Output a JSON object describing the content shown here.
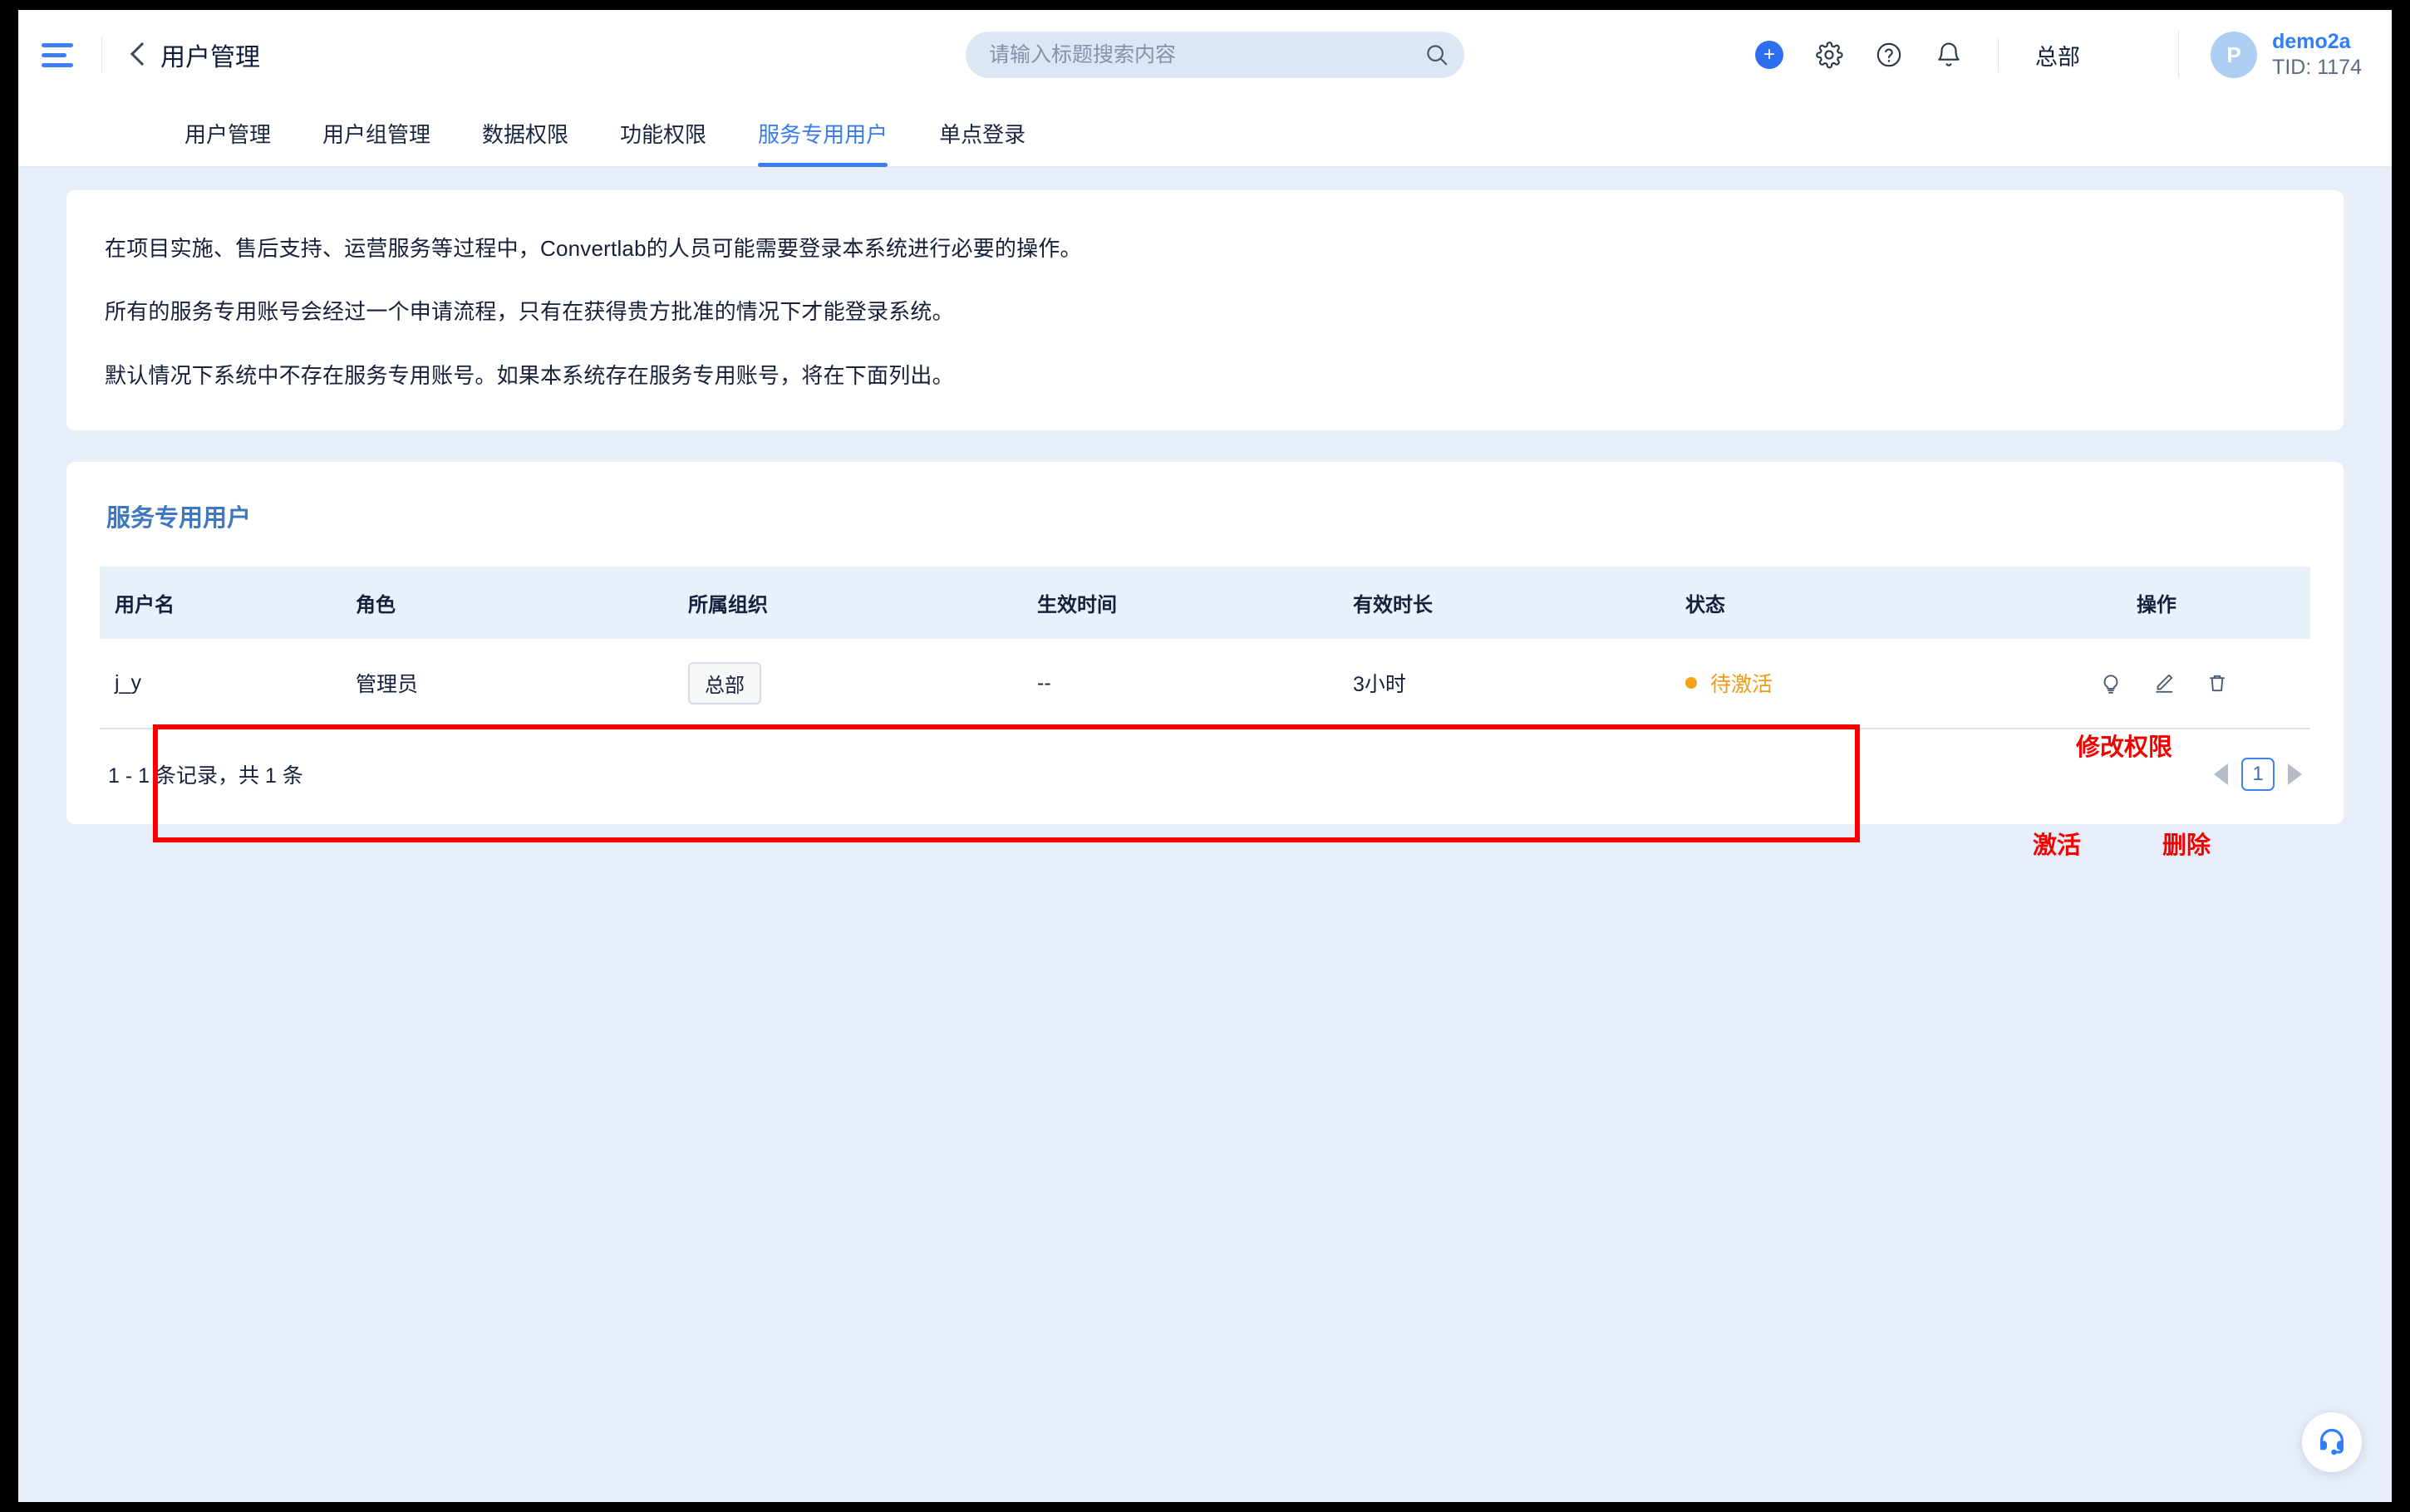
{
  "header": {
    "menu_icon": "hamburger-icon",
    "back_icon": "back-chevron-icon",
    "page_title": "用户管理",
    "search": {
      "placeholder": "请输入标题搜索内容",
      "value": "",
      "icon": "search-icon"
    },
    "actions": [
      {
        "name": "add-button",
        "icon": "plus-icon"
      },
      {
        "name": "settings-button",
        "icon": "gear-icon"
      },
      {
        "name": "help-button",
        "icon": "question-circle-icon"
      },
      {
        "name": "notifications-button",
        "icon": "bell-icon"
      }
    ],
    "org_label": "总部",
    "user": {
      "avatar_letter": "P",
      "name": "demo2a",
      "tid": "TID: 1174"
    }
  },
  "tabs": [
    {
      "label": "用户管理",
      "active": false
    },
    {
      "label": "用户组管理",
      "active": false
    },
    {
      "label": "数据权限",
      "active": false
    },
    {
      "label": "功能权限",
      "active": false
    },
    {
      "label": "服务专用用户",
      "active": true
    },
    {
      "label": "单点登录",
      "active": false
    }
  ],
  "info_card": {
    "lines": [
      "在项目实施、售后支持、运营服务等过程中，Convertlab的人员可能需要登录本系统进行必要的操作。",
      "所有的服务专用账号会经过一个申请流程，只有在获得贵方批准的情况下才能登录系统。",
      "默认情况下系统中不存在服务专用账号。如果本系统存在服务专用账号，将在下面列出。"
    ]
  },
  "table_card": {
    "title": "服务专用用户",
    "columns": [
      "用户名",
      "角色",
      "所属组织",
      "生效时间",
      "有效时长",
      "状态",
      "操作"
    ],
    "rows": [
      {
        "username": "j_y",
        "role": "管理员",
        "org": "总部",
        "effective_time": "--",
        "duration": "3小时",
        "status": "待激活",
        "status_color": "#f09a17",
        "actions": [
          {
            "name": "activate-icon",
            "icon": "bulb-icon"
          },
          {
            "name": "edit-permission-icon",
            "icon": "pencil-icon"
          },
          {
            "name": "delete-icon",
            "icon": "trash-icon"
          }
        ]
      }
    ],
    "annotations": {
      "box_color": "#f80000",
      "modify": "修改权限",
      "activate": "激活",
      "delete": "删除"
    },
    "pagination": {
      "info": "1 - 1 条记录，共 1 条",
      "prev_icon": "triangle-left-icon",
      "current_page": "1",
      "next_icon": "triangle-right-icon"
    }
  },
  "fab": {
    "icon": "headset-icon"
  },
  "colors": {
    "accent": "#3b7bf0",
    "background": "#e8eef9",
    "card": "#ffffff",
    "table_header": "#e8f0fb",
    "annotation_red": "#f80000",
    "status_orange": "#f09a17"
  }
}
